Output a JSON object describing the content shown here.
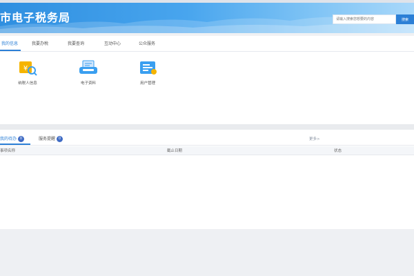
{
  "header": {
    "site_title": "市电子税务局",
    "search_placeholder": "请输入搜索您想要的内容",
    "search_button": "搜索"
  },
  "nav": {
    "tabs": [
      {
        "label": "我的信息",
        "active": true
      },
      {
        "label": "我要办税",
        "active": false
      },
      {
        "label": "我要查询",
        "active": false
      },
      {
        "label": "互动中心",
        "active": false
      },
      {
        "label": "公众服务",
        "active": false
      }
    ]
  },
  "apps": [
    {
      "label": "纳税人信息",
      "icon": "taxpayer-info-icon"
    },
    {
      "label": "电子资料",
      "icon": "electronic-documents-icon"
    },
    {
      "label": "用户管理",
      "icon": "user-management-icon"
    }
  ],
  "todo": {
    "tabs": [
      {
        "label": "我的待办",
        "badge": "0",
        "active": true
      },
      {
        "label": "服务提醒",
        "badge": "0",
        "active": false
      }
    ],
    "more_label": "更多>",
    "columns": [
      "事项名称",
      "截止日期",
      "状态"
    ]
  },
  "colors": {
    "accent": "#2b7fd6",
    "banner_start": "#2f8fe0",
    "banner_end": "#a9d8fa",
    "app_icon_blue": "#3a9ff0",
    "app_icon_yellow": "#f5b400"
  }
}
